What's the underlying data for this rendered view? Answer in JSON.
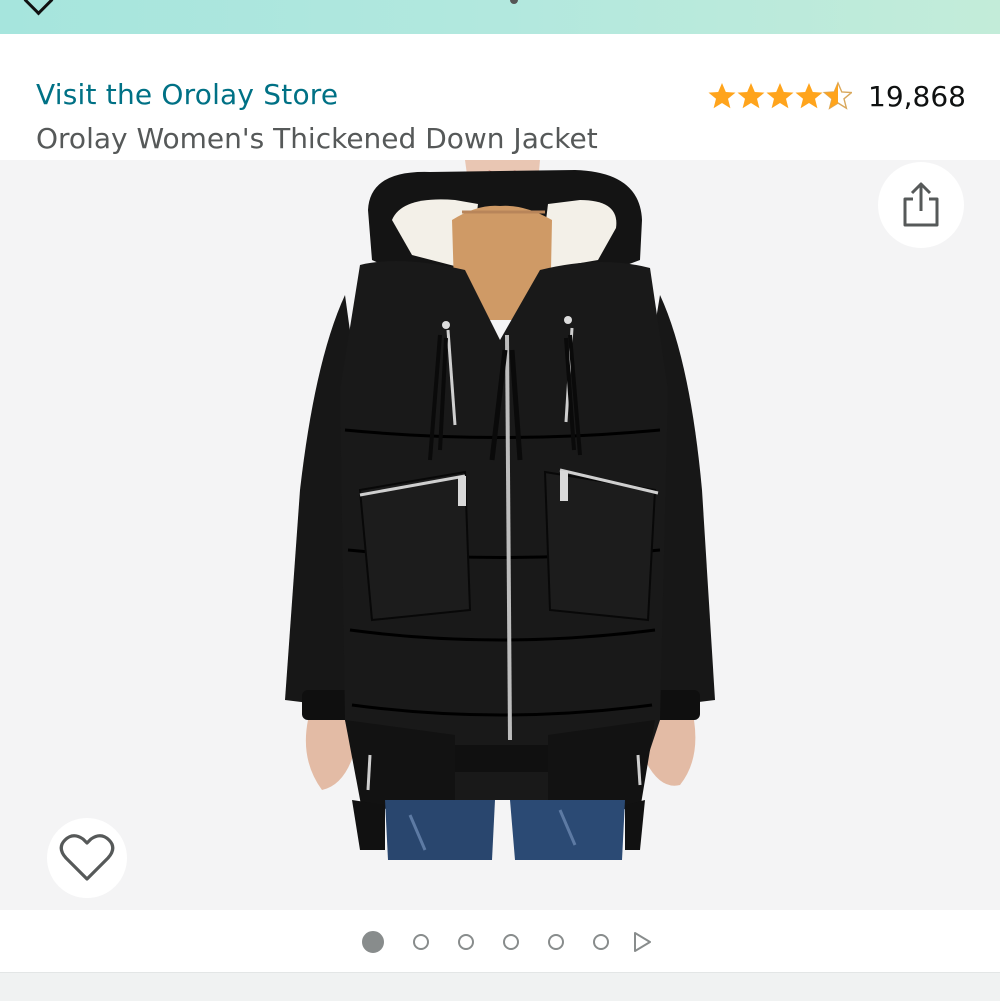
{
  "header": {
    "store_link": "Visit the Orolay Store",
    "product_title": "Orolay Women's Thickened Down Jacket"
  },
  "rating": {
    "stars": 4.5,
    "count": "19,868",
    "star_color": "#ffa41c"
  },
  "colors": {
    "link": "#007185",
    "title": "#565959",
    "jacket": "#161616",
    "sherpa": "#f2efe6",
    "sweater": "#cf9a66"
  },
  "image": {
    "subject": "product-photo-black-down-jacket"
  },
  "actions": {
    "share_icon": "share-icon",
    "wishlist_icon": "heart-icon"
  },
  "carousel": {
    "total_dots": 6,
    "active_index": 0,
    "next_icon": "play-icon"
  }
}
